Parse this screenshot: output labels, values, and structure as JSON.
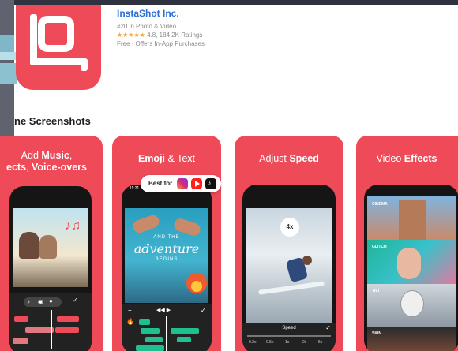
{
  "app": {
    "name": "InstaShot Inc.",
    "rank": "#20 in Photo & Video",
    "stars": "★★★★★",
    "rating": "4.8, 184.2K Ratings",
    "price": "Free · Offers In-App Purchases"
  },
  "section_title": "ne Screenshots",
  "cards": [
    {
      "title_line1_a": "Add ",
      "title_line1_b": "Music",
      "title_line1_c": ",",
      "title_line2_a": "ects",
      "title_line2_b": ", ",
      "title_line2_c": "Voice-overs"
    },
    {
      "title_a": "Emoji",
      "title_b": " & Text"
    },
    {
      "title_a": "Adjust ",
      "title_b": "Speed"
    },
    {
      "title_a": "Video ",
      "title_b": "Effects"
    }
  ],
  "badge": {
    "label": "Best for"
  },
  "phone_speed": {
    "value": "4x",
    "label": "Speed",
    "marks": [
      "0.2x",
      "0.5x",
      "1x",
      "2x",
      "5x"
    ]
  },
  "phone_effects": {
    "filters": [
      "CINEMA",
      "GLITCH",
      "TILT",
      "SKIN"
    ]
  },
  "phone_emoji": {
    "scene_line1": "AND THE",
    "scene_line2": "adventure",
    "scene_line3": "BEGINS"
  },
  "colors": {
    "brand": "#ee4a57",
    "link": "#2b6fd6",
    "star": "#f39b2c"
  }
}
